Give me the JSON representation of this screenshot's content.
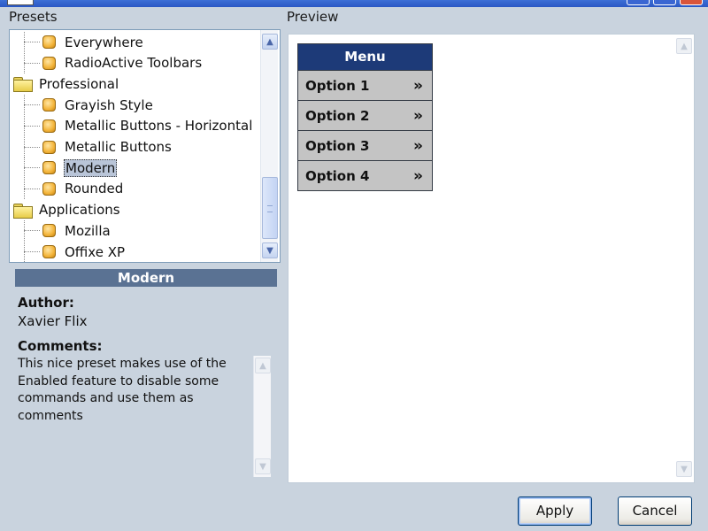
{
  "presets_label": "Presets",
  "preview_label": "Preview",
  "tree": [
    {
      "type": "preset",
      "label": "Everywhere",
      "indent": 1
    },
    {
      "type": "preset",
      "label": "RadioActive Toolbars",
      "indent": 1
    },
    {
      "type": "folder",
      "label": "Professional",
      "indent": 0
    },
    {
      "type": "preset",
      "label": "Grayish Style",
      "indent": 1
    },
    {
      "type": "preset",
      "label": "Metallic Buttons - Horizontal",
      "indent": 1
    },
    {
      "type": "preset",
      "label": "Metallic Buttons",
      "indent": 1
    },
    {
      "type": "preset",
      "label": "Modern",
      "indent": 1,
      "selected": true
    },
    {
      "type": "preset",
      "label": "Rounded",
      "indent": 1
    },
    {
      "type": "folder",
      "label": "Applications",
      "indent": 0
    },
    {
      "type": "preset",
      "label": "Mozilla",
      "indent": 1
    },
    {
      "type": "preset",
      "label": "Offixe XP",
      "indent": 1
    }
  ],
  "info": {
    "title": "Modern",
    "author_label": "Author:",
    "author": "Xavier Flix",
    "comments_label": "Comments:",
    "comments": "This nice preset makes use of the Enabled feature to disable some commands and use them as comments"
  },
  "preview_menu": {
    "header": "Menu",
    "items": [
      "Option 1",
      "Option 2",
      "Option 3",
      "Option 4"
    ],
    "chevron": "»"
  },
  "buttons": {
    "apply": "Apply",
    "cancel": "Cancel"
  },
  "colors": {
    "menu_header": "#1d3a78",
    "menu_item": "#c4c4c4",
    "info_header": "#5a7293",
    "window_bg": "#c9d3de"
  }
}
